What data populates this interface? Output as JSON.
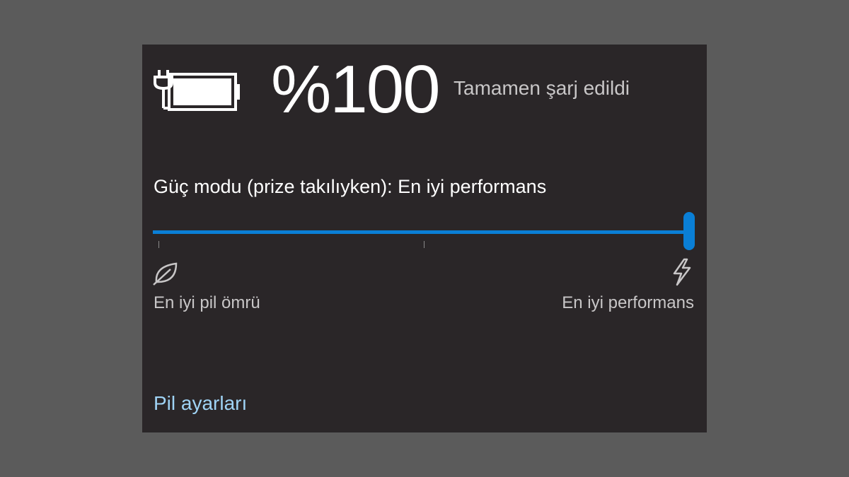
{
  "battery": {
    "icon": "battery-charging-icon",
    "percent": "%100",
    "status": "Tamamen şarj edildi"
  },
  "power_mode": {
    "label": "Güç modu (prize takılıyken): En iyi performans",
    "slider_value": 1.0,
    "slider_steps": 3,
    "accent_color": "#0a7fd6",
    "min_icon": "leaf-icon",
    "max_icon": "lightning-icon",
    "min_label": "En iyi pil ömrü",
    "max_label": "En iyi performans"
  },
  "footer": {
    "settings_link": "Pil ayarları",
    "link_color": "#9fd3f5"
  }
}
